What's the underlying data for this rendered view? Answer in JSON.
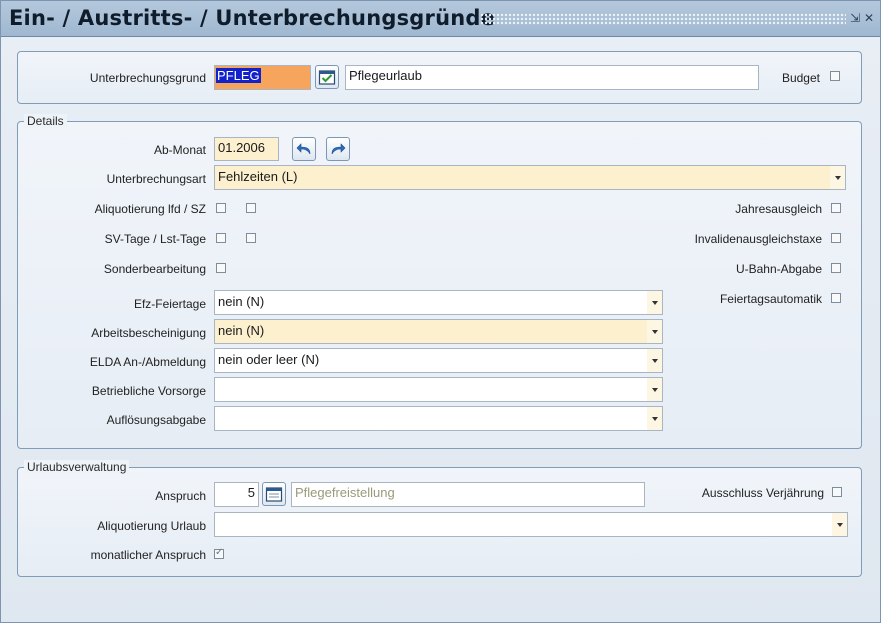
{
  "window": {
    "title": "Ein- / Austritts- / Unterbrechungsgründe",
    "minimize_glyph": "⇲",
    "close_glyph": "✕"
  },
  "top": {
    "grund_label": "Unterbrechungsgrund",
    "grund_code": "PFLEG",
    "grund_text": "Pflegeurlaub",
    "budget_label": "Budget",
    "budget_checked": false
  },
  "details": {
    "legend": "Details",
    "ab_monat_label": "Ab-Monat",
    "ab_monat_value": "01.2006",
    "art_label": "Unterbrechungsart",
    "art_value": "Fehlzeiten (L)",
    "aliq_label": "Aliquotierung lfd / SZ",
    "sv_label": "SV-Tage / Lst-Tage",
    "sonder_label": "Sonderbearbeitung",
    "jahres_label": "Jahresausgleich",
    "invaliden_label": "Invalidenausgleichstaxe",
    "ubahn_label": "U-Bahn-Abgabe",
    "feiertagsautomatik_label": "Feiertagsautomatik",
    "efz_label": "Efz-Feiertage",
    "efz_value": "nein (N)",
    "arbeits_label": "Arbeitsbescheinigung",
    "arbeits_value": "nein (N)",
    "elda_label": "ELDA An-/Abmeldung",
    "elda_value": "nein oder leer (N)",
    "vorsorge_label": "Betriebliche Vorsorge",
    "vorsorge_value": "",
    "aufloesung_label": "Auflösungsabgabe",
    "aufloesung_value": ""
  },
  "urlaub": {
    "legend": "Urlaubsverwaltung",
    "anspruch_label": "Anspruch",
    "anspruch_value": "5",
    "anspruch_text": "Pflegefreistellung",
    "ausschluss_label": "Ausschluss Verjährung",
    "aliq_label": "Aliquotierung Urlaub",
    "aliq_value": "",
    "monatlich_label": "monatlicher Anspruch",
    "monatlich_checked": true
  },
  "colors": {
    "title_bg": "#a9bfd6",
    "highlight_orange": "#f7a55c",
    "selection_blue": "#1122cc",
    "field_yellow": "#fdf0cf"
  }
}
